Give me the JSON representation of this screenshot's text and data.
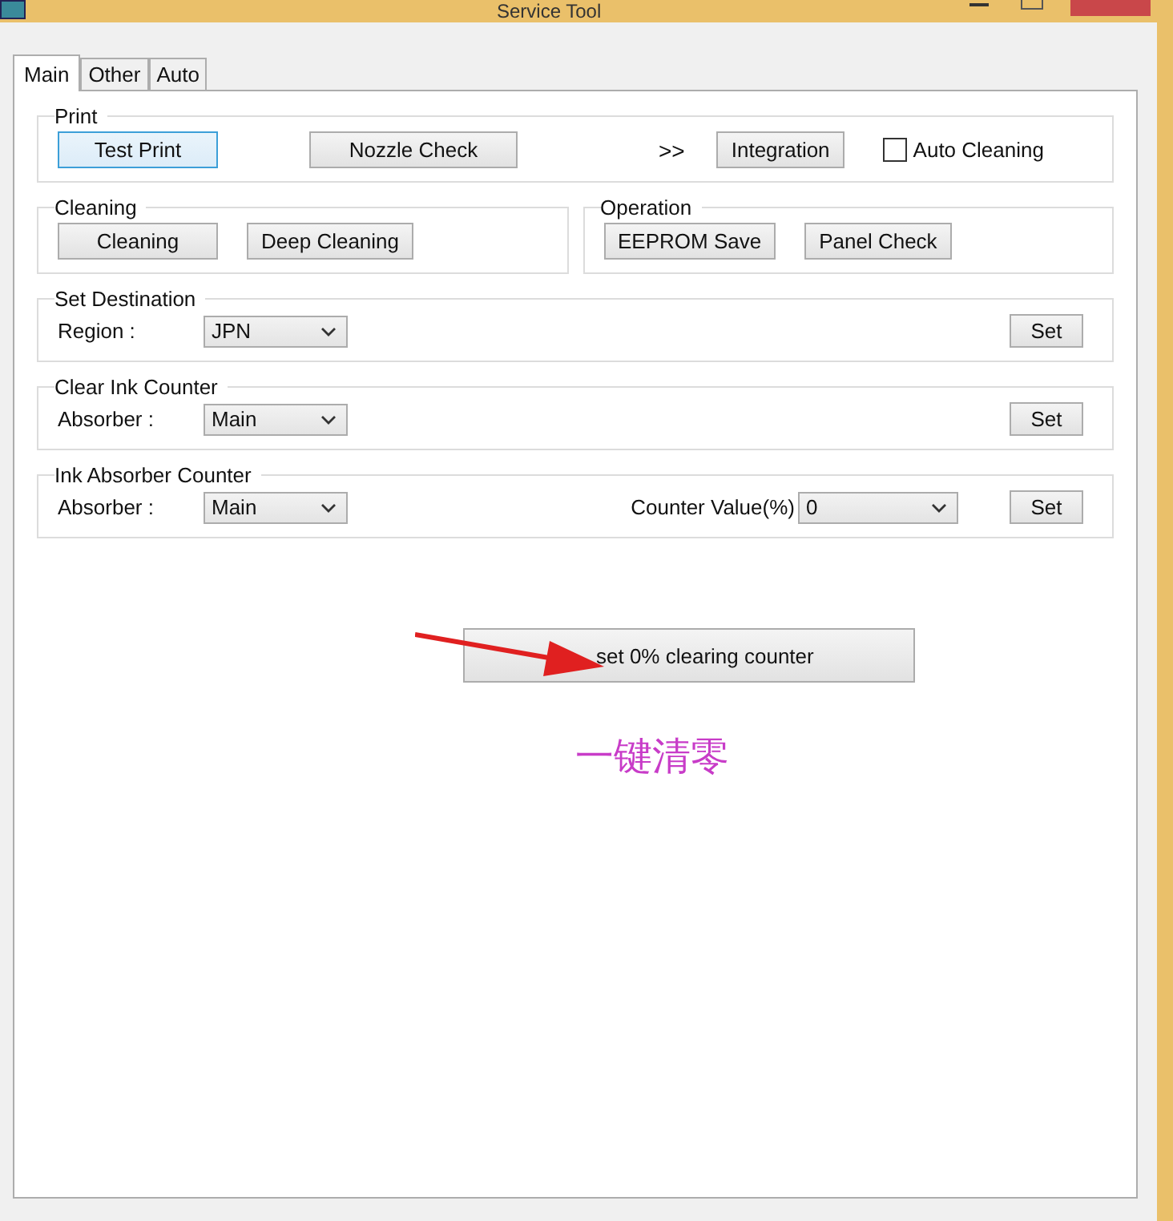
{
  "window": {
    "title": "Service Tool"
  },
  "tabs": [
    {
      "label": "Main",
      "selected": true
    },
    {
      "label": "Other",
      "selected": false
    },
    {
      "label": "Auto",
      "selected": false
    }
  ],
  "print": {
    "title": "Print",
    "test_print": "Test Print",
    "nozzle_check": "Nozzle Check",
    "arrows": ">>",
    "integration": "Integration",
    "auto_cleaning": {
      "label": "Auto Cleaning",
      "checked": false
    }
  },
  "cleaning": {
    "title": "Cleaning",
    "buttons": [
      "Cleaning",
      "Deep Cleaning"
    ]
  },
  "operation": {
    "title": "Operation",
    "buttons": [
      "EEPROM Save",
      "Panel Check"
    ]
  },
  "set_destination": {
    "title": "Set Destination",
    "label": "Region :",
    "value": "JPN",
    "button": "Set"
  },
  "clear_ink_counter": {
    "title": "Clear Ink Counter",
    "label": "Absorber :",
    "value": "Main",
    "button": "Set"
  },
  "ink_absorber_counter": {
    "title": "Ink Absorber Counter",
    "label": "Absorber :",
    "value": "Main",
    "counter_label": "Counter Value(%)",
    "counter_value": "0",
    "button": "Set"
  },
  "clear_button": "set 0% clearing counter",
  "annotation": "一键清零"
}
